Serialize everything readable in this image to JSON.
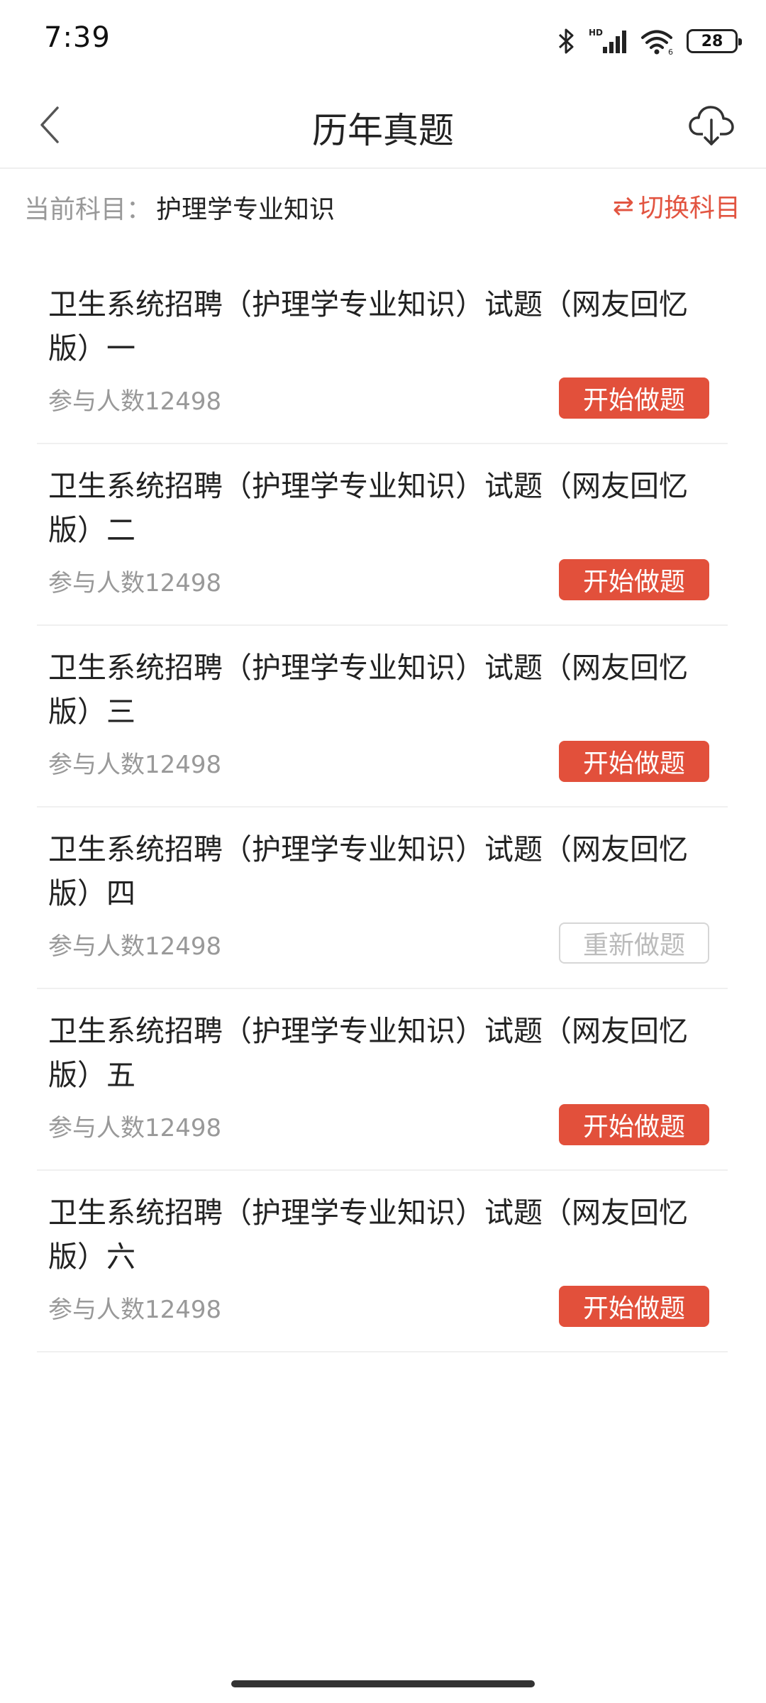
{
  "status_bar": {
    "time": "7:39",
    "battery": "28",
    "icons": [
      "bluetooth-icon",
      "hd-signal-icon",
      "wifi-icon",
      "battery-icon"
    ]
  },
  "header": {
    "title": "历年真题",
    "back_icon": "chevron-left-icon",
    "download_icon": "cloud-download-icon"
  },
  "subject": {
    "label": "当前科目：",
    "value": "护理学专业知识",
    "switch_label": "切换科目",
    "switch_icon": "⇄"
  },
  "exams": [
    {
      "title": "卫生系统招聘（护理学专业知识）试题（网友回忆版）一",
      "participants": "参与人数12498",
      "action": "开始做题",
      "state": "start"
    },
    {
      "title": "卫生系统招聘（护理学专业知识）试题（网友回忆版）二",
      "participants": "参与人数12498",
      "action": "开始做题",
      "state": "start"
    },
    {
      "title": "卫生系统招聘（护理学专业知识）试题（网友回忆版）三",
      "participants": "参与人数12498",
      "action": "开始做题",
      "state": "start"
    },
    {
      "title": "卫生系统招聘（护理学专业知识）试题（网友回忆版）四",
      "participants": "参与人数12498",
      "action": "重新做题",
      "state": "redo"
    },
    {
      "title": "卫生系统招聘（护理学专业知识）试题（网友回忆版）五",
      "participants": "参与人数12498",
      "action": "开始做题",
      "state": "start"
    },
    {
      "title": "卫生系统招聘（护理学专业知识）试题（网友回忆版）六",
      "participants": "参与人数12498",
      "action": "开始做题",
      "state": "start"
    }
  ],
  "colors": {
    "accent": "#e2503b",
    "muted_text": "#999999",
    "disabled_border": "#d6d6d6"
  }
}
